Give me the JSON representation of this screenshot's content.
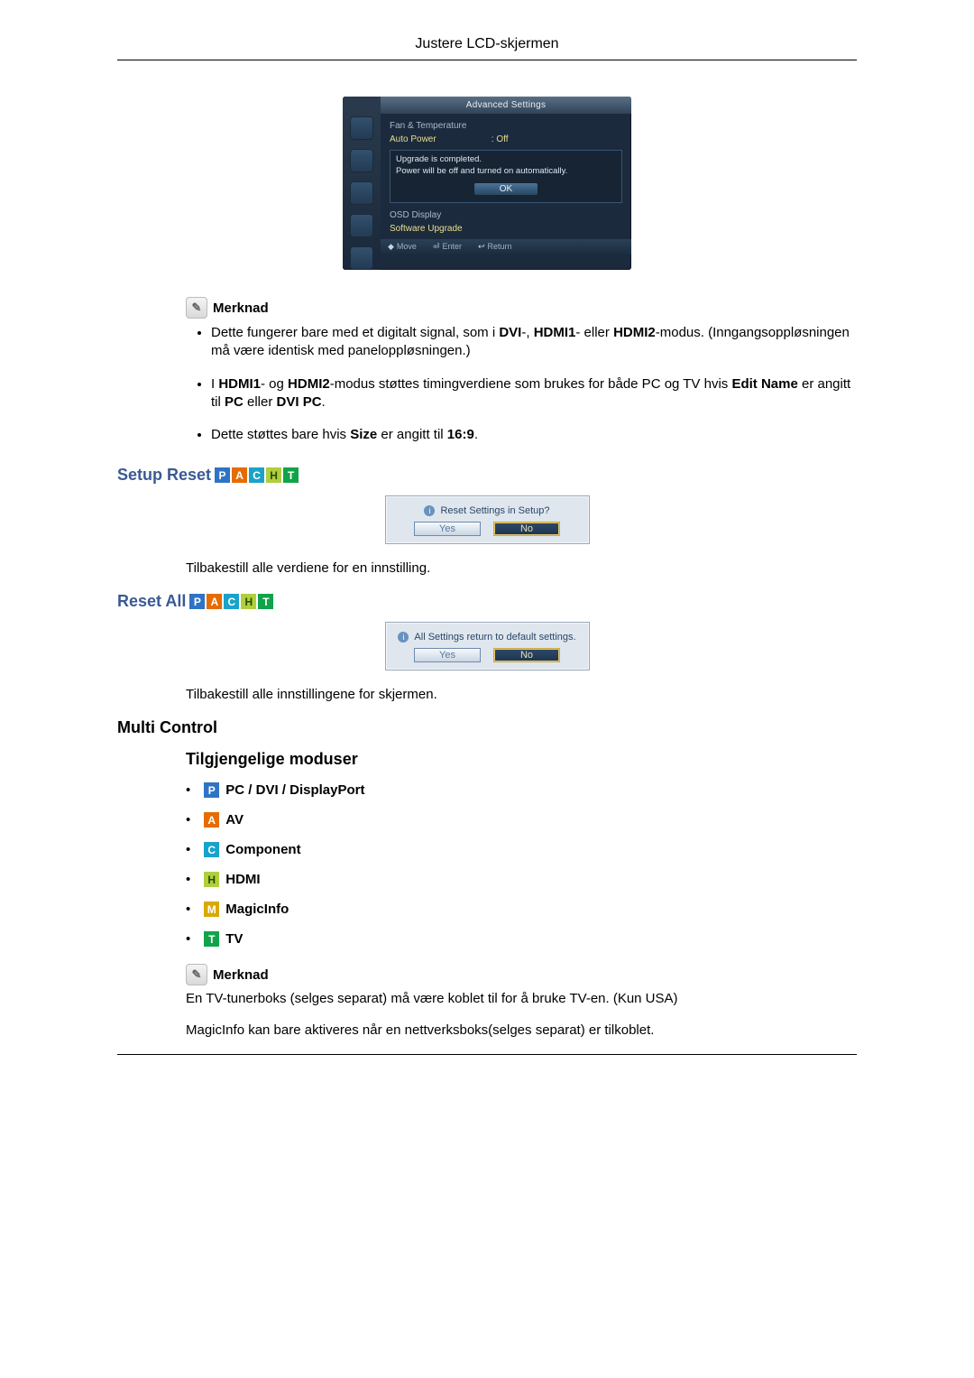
{
  "header": {
    "title": "Justere LCD-skjermen"
  },
  "osd": {
    "title": "Advanced Settings",
    "rows": {
      "fan": "Fan & Temperature",
      "auto_power_label": "Auto Power",
      "auto_power_value": ": Off",
      "osd_display": "OSD Display",
      "sw_upgrade": "Software Upgrade"
    },
    "dialog": {
      "line1": "Upgrade is completed.",
      "line2": "Power will be off and turned on automatically.",
      "ok": "OK"
    },
    "footer": {
      "move": "Move",
      "enter": "Enter",
      "ret": "Return"
    }
  },
  "note1": {
    "label": "Merknad",
    "items": [
      "Dette fungerer bare med et digitalt signal, som i <b>DVI</b>-, <b>HDMI1</b>- eller <b>HDMI2</b>-modus. (Inngangsoppløsningen må være identisk med paneloppløsningen.)",
      "I <b>HDMI1</b>- og <b>HDMI2</b>-modus støttes timingverdiene som brukes for både PC og TV hvis <b>Edit Name</b> er angitt til <b>PC</b> eller <b>DVI PC</b>.",
      "Dette støttes bare hvis <b>Size</b> er angitt til <b>16:9</b>."
    ]
  },
  "setup_reset": {
    "heading": "Setup Reset",
    "dialog_q": "Reset Settings in Setup?",
    "yes": "Yes",
    "no": "No",
    "desc": "Tilbakestill alle verdiene for en innstilling."
  },
  "reset_all": {
    "heading": "Reset All",
    "dialog_q": "All Settings return to default settings.",
    "yes": "Yes",
    "no": "No",
    "desc": "Tilbakestill alle innstillingene for skjermen."
  },
  "multi_control": {
    "heading": "Multi Control",
    "sub": "Tilgjengelige moduser",
    "modes": {
      "p": "PC / DVI / DisplayPort",
      "a": "AV",
      "c": "Component",
      "h": "HDMI",
      "m": "MagicInfo",
      "t": "TV"
    }
  },
  "note2": {
    "label": "Merknad",
    "p1": "En TV-tunerboks (selges separat) må være koblet til for å bruke TV-en. (Kun USA)",
    "p2": "MagicInfo kan bare aktiveres når en nettverksboks(selges separat) er tilkoblet."
  }
}
